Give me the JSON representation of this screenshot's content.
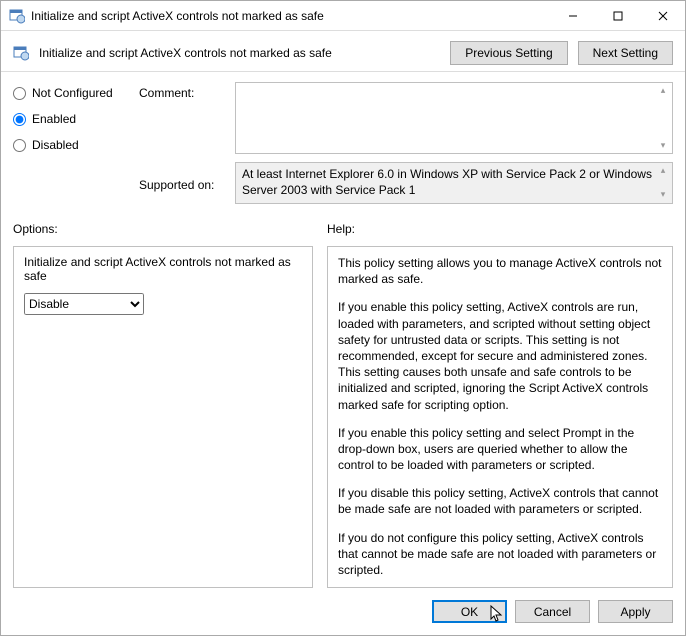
{
  "window": {
    "title": "Initialize and script ActiveX controls not marked as safe",
    "subtitle": "Initialize and script ActiveX controls not marked as safe"
  },
  "nav": {
    "prev": "Previous Setting",
    "next": "Next Setting"
  },
  "state": {
    "not_configured": "Not Configured",
    "enabled": "Enabled",
    "disabled": "Disabled",
    "selected": "Enabled"
  },
  "comment": {
    "label": "Comment:",
    "value": ""
  },
  "supported": {
    "label": "Supported on:",
    "value": "At least Internet Explorer 6.0 in Windows XP with Service Pack 2 or Windows Server 2003 with Service Pack 1"
  },
  "sections": {
    "options": "Options:",
    "help": "Help:"
  },
  "options_panel": {
    "text": "Initialize and script ActiveX controls not marked as safe",
    "dropdown_value": "Disable"
  },
  "help_panel": {
    "p1": "This policy setting allows you to manage ActiveX controls not marked as safe.",
    "p2": "If you enable this policy setting, ActiveX controls are run, loaded with parameters, and scripted without setting object safety for untrusted data or scripts. This setting is not recommended, except for secure and administered zones. This setting causes both unsafe and safe controls to be initialized and scripted, ignoring the Script ActiveX controls marked safe for scripting option.",
    "p3": "If you enable this policy setting and select Prompt in the drop-down box, users are queried whether to allow the control to be loaded with parameters or scripted.",
    "p4": "If you disable this policy setting, ActiveX controls that cannot be made safe are not loaded with parameters or scripted.",
    "p5": "If you do not configure this policy setting, ActiveX controls that cannot be made safe are not loaded with parameters or scripted."
  },
  "buttons": {
    "ok": "OK",
    "cancel": "Cancel",
    "apply": "Apply"
  }
}
